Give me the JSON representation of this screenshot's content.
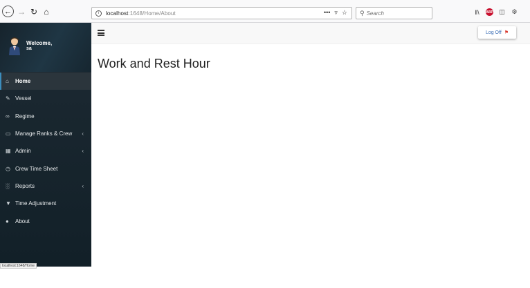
{
  "browser": {
    "url_host": "localhost",
    "url_path": ":1648/Home/About",
    "search_placeholder": "Search",
    "status_url": "localhost:1648/Home"
  },
  "user": {
    "welcome": "Welcome,",
    "name": "sa"
  },
  "sidebar": {
    "items": [
      {
        "label": "Home",
        "icon": "home-icon",
        "active": true
      },
      {
        "label": "Vessel",
        "icon": "edit-icon"
      },
      {
        "label": "Regime",
        "icon": "link-icon"
      },
      {
        "label": "Manage Ranks & Crew",
        "icon": "desktop-icon",
        "has_children": true
      },
      {
        "label": "Admin",
        "icon": "table-icon",
        "has_children": true
      },
      {
        "label": "Crew Time Sheet",
        "icon": "clock-icon"
      },
      {
        "label": "Reports",
        "icon": "bar-chart-icon",
        "has_children": true
      },
      {
        "label": "Time Adjustment",
        "icon": "filter-icon"
      },
      {
        "label": "About",
        "icon": "user-icon"
      }
    ]
  },
  "header": {
    "logoff_label": "Log Off"
  },
  "main": {
    "title": "Work and Rest Hour"
  },
  "colors": {
    "sidebar_bg": "#1d2a33",
    "active_item": "#2b353c",
    "logoff_text": "#3c6fb6",
    "logoff_icon": "#d9362b"
  }
}
